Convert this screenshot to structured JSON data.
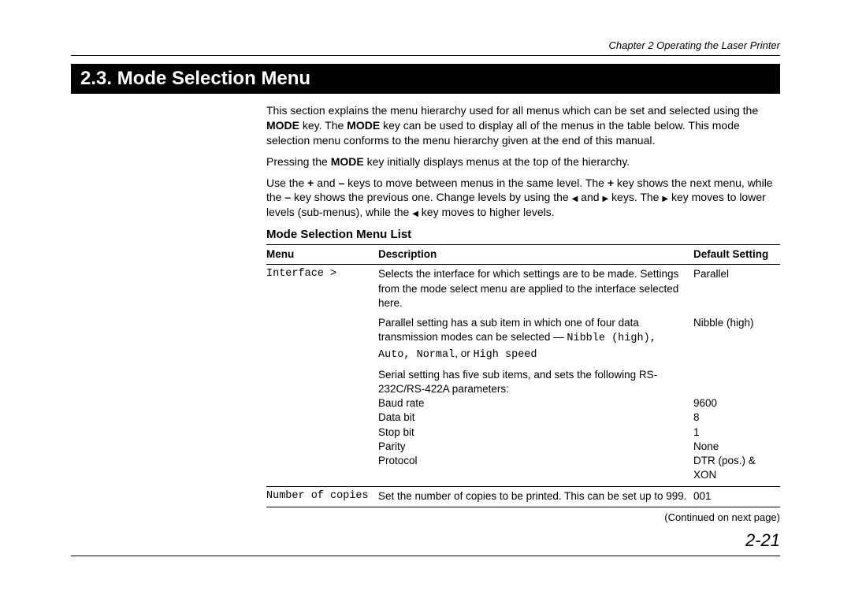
{
  "header": {
    "chapter_line": "Chapter 2  Operating the Laser Printer"
  },
  "section": {
    "number": "2.3.",
    "title": "Mode Selection Menu"
  },
  "intro": {
    "p1_a": "This section explains the menu hierarchy used for all menus which can be set and selected using the ",
    "mode_key": "MODE",
    "p1_b": " key.  The ",
    "p1_c": " key can be used to display all of the menus in the table below.  This mode selection menu conforms to the menu hierarchy given at the end of this manual.",
    "p2_a": "Pressing the ",
    "p2_b": " key initially displays menus at the top of the hierarchy.",
    "p3_a": "Use the ",
    "plus": "+",
    "p3_b": " and ",
    "minus": "–",
    "p3_c": " keys to move between menus in the same level.  The ",
    "p3_d": " key shows the next menu, while the ",
    "p3_e": " key shows the previous one.  Change levels by using the ",
    "tri_left": "◀",
    "p3_f": " and ",
    "tri_right": "▶",
    "p3_g": " keys.  The ",
    "p3_h": " key moves to lower levels (sub-menus), while the ",
    "p3_i": " key moves to higher levels."
  },
  "list": {
    "subheading": "Mode Selection Menu List",
    "headers": {
      "menu": "Menu",
      "description": "Description",
      "default": "Default Setting"
    },
    "rows": {
      "r0": {
        "menu": "Interface >",
        "desc": "Selects the interface for which settings are to be made. Settings from the mode select menu are applied to the interface selected here.",
        "def": "Parallel"
      },
      "r1": {
        "desc_a": "Parallel setting has a sub item in which one of four data transmission modes can be selected — ",
        "mono_a": "Nibble (high)",
        "sep1": ", ",
        "mono_b": "Auto",
        "sep2": ", ",
        "mono_c": "Normal",
        "or": ", or ",
        "mono_d": "High speed",
        "def": "Nibble (high)"
      },
      "r2": {
        "desc": "Serial setting has five sub items, and sets the following RS-232C/RS-422A parameters:"
      },
      "r3": {
        "label": "Baud rate",
        "def": "9600"
      },
      "r4": {
        "label": "Data bit",
        "def": "8"
      },
      "r5": {
        "label": "Stop bit",
        "def": "1"
      },
      "r6": {
        "label": "Parity",
        "def": "None"
      },
      "r7": {
        "label": "Protocol",
        "def": "DTR (pos.) & XON"
      },
      "r8": {
        "menu": "Number of copies",
        "desc": "Set the number of copies to be printed.  This can be set up to 999.",
        "def": "001"
      }
    },
    "continued": "(Continued on next page)"
  },
  "page_number": "2-21"
}
